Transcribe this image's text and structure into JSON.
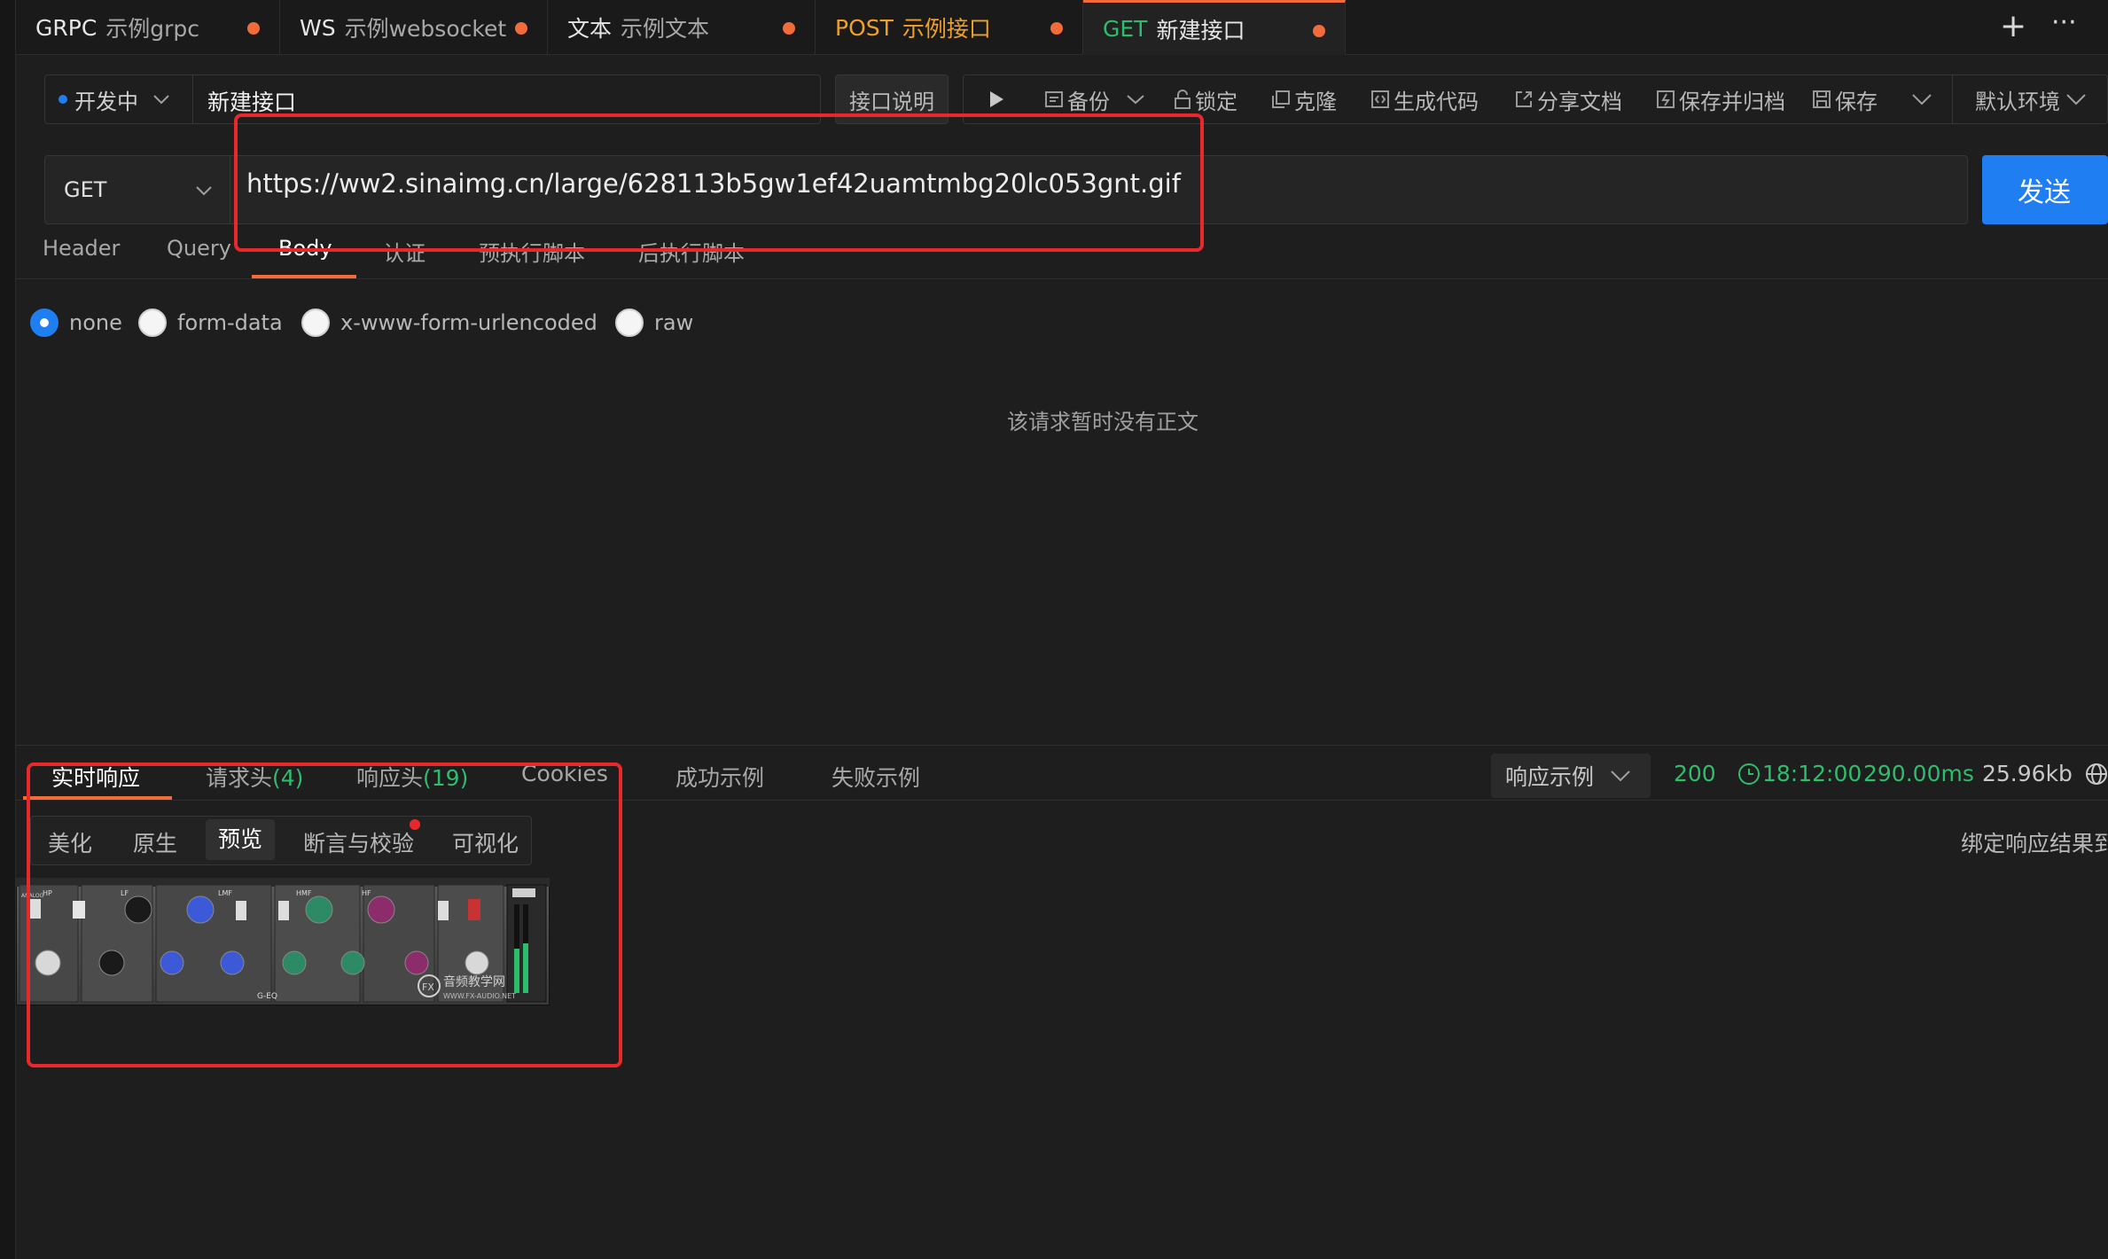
{
  "tabs": [
    {
      "method": "GRPC",
      "name": "示例grpc",
      "method_color": "#e6e6e6"
    },
    {
      "method": "WS",
      "name": "示例websocket",
      "method_color": "#e6e6e6"
    },
    {
      "method": "文本",
      "name": "示例文本",
      "method_color": "#e6e6e6"
    },
    {
      "method": "POST",
      "name": "示例接口",
      "method_color": "#f0a028"
    },
    {
      "method": "GET",
      "name": "新建接口",
      "method_color": "#2ebd6b",
      "active": true
    }
  ],
  "toolbar": {
    "status": "开发中",
    "status_color": "#1f7ef2",
    "api_name": "新建接口",
    "doc_button": "接口说明",
    "backup": "备份",
    "lock": "锁定",
    "clone": "克隆",
    "gen_code": "生成代码",
    "share_doc": "分享文档",
    "save_archive": "保存并归档",
    "save": "保存",
    "env": "默认环境"
  },
  "request": {
    "method": "GET",
    "url": "https://ww2.sinaimg.cn/large/628113b5gw1ef42uamtmbg20lc053gnt.gif",
    "send": "发送",
    "tabs": [
      "Header",
      "Query",
      "Body",
      "认证",
      "预执行脚本",
      "后执行脚本"
    ],
    "active_tab": "Body",
    "body_types": [
      "none",
      "form-data",
      "x-www-form-urlencoded",
      "raw"
    ],
    "selected_body_type": "none",
    "empty_text": "该请求暂时没有正文"
  },
  "response": {
    "tabs": [
      "实时响应",
      "请求头",
      "响应头",
      "Cookies",
      "成功示例",
      "失败示例"
    ],
    "req_header_count": "(4)",
    "resp_header_count": "(19)",
    "active_tab": "实时响应",
    "example_select": "响应示例",
    "status_code": "200",
    "time": "18:12:00",
    "duration": "290.00ms",
    "size": "25.96kb",
    "sub_tabs": [
      "美化",
      "原生",
      "预览",
      "断言与校验",
      "可视化"
    ],
    "active_sub_tab": "预览",
    "bind_text": "绑定响应结果到",
    "preview_image": {
      "bands": [
        "HP",
        "LF",
        "LMF",
        "HMF",
        "HF"
      ],
      "model": "G-EQ",
      "watermark": "音频教学网",
      "watermark_url": "WWW.FX-AUDIO.NET",
      "analog": "ANALOG"
    }
  },
  "colors": {
    "accent": "#f26b3a",
    "primary": "#1f7ef2",
    "success": "#2ebd6b",
    "annotation": "#e8282b"
  }
}
